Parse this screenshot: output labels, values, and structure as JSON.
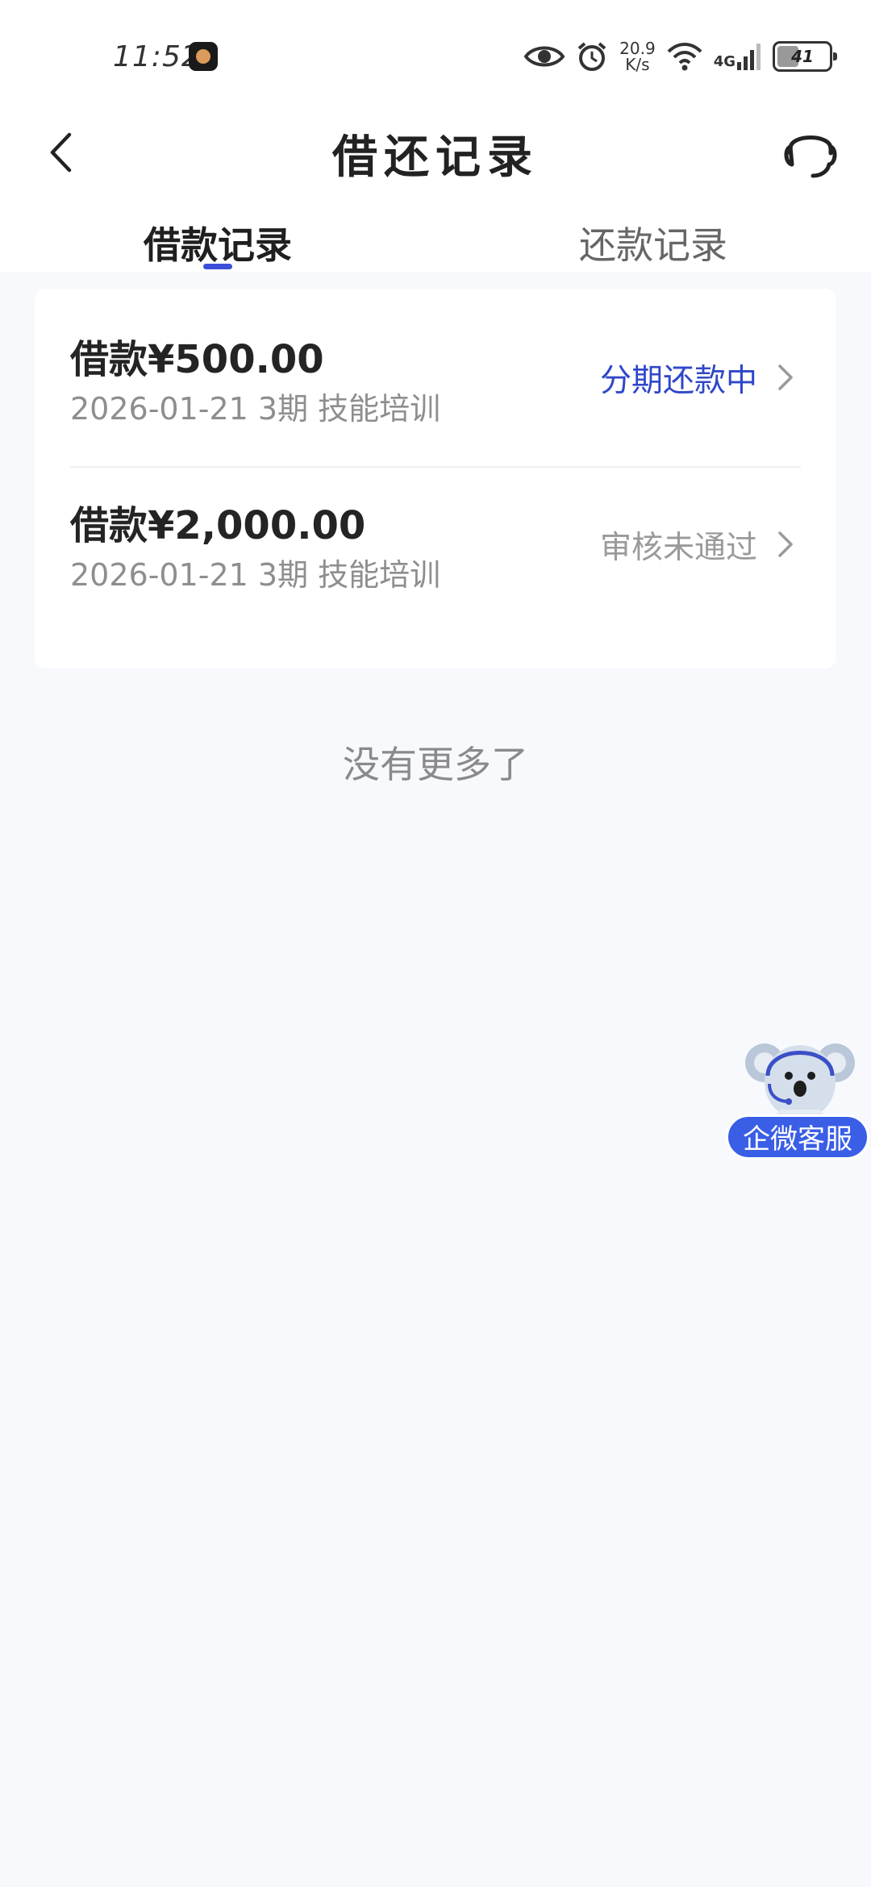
{
  "status_bar": {
    "time": "11:52",
    "net_speed_value": "20.9",
    "net_speed_unit": "K/s",
    "network": "4G",
    "battery": "41"
  },
  "nav": {
    "title": "借还记录"
  },
  "tabs": [
    {
      "label": "借款记录",
      "active": true
    },
    {
      "label": "还款记录",
      "active": false
    }
  ],
  "records": [
    {
      "amount": "借款¥500.00",
      "meta": "2026-01-21 3期  技能培训",
      "status": "分期还款中",
      "status_color": "#2f47c8"
    },
    {
      "amount": "借款¥2,000.00",
      "meta": "2026-01-21 3期  技能培训",
      "status": "审核未通过",
      "status_color": "#9a9a9a"
    }
  ],
  "list_end_text": "没有更多了",
  "floating_service": {
    "label": "企微客服",
    "icon": "koala-mascot-icon"
  },
  "colors": {
    "accent": "#3b4fd8",
    "background": "#f7f9fd"
  }
}
